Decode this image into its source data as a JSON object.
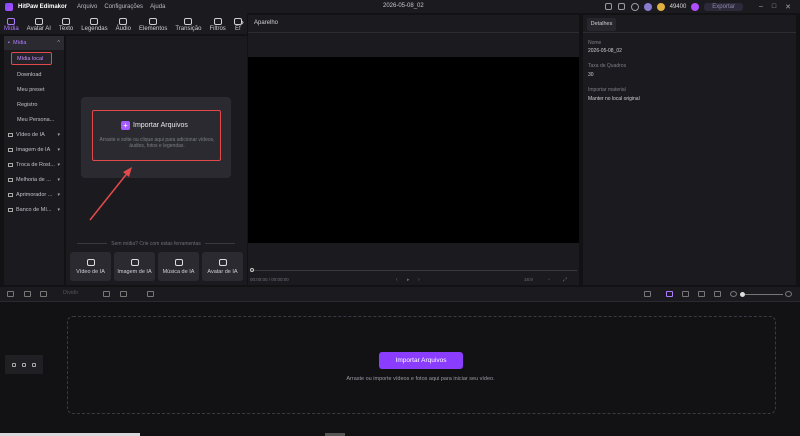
{
  "titlebar": {
    "app_name": "HitPaw Edimakor",
    "menu": [
      "Arquivo",
      "Configurações",
      "Ajuda"
    ],
    "project_title": "2026-05-08_02",
    "credits": "49400",
    "export_label": "Exportar"
  },
  "toolbar": {
    "tools": [
      "Mídia",
      "Avatar AI",
      "Texto",
      "Legendas",
      "Áudio",
      "Elementos",
      "Transição",
      "Filtros",
      "Ef"
    ]
  },
  "sidebar": {
    "header": "Mídia",
    "sub_items": [
      "Mídia local",
      "Download",
      "Meu preset",
      "Registro",
      "Meu Persona..."
    ],
    "categories": [
      "Vídeo de IA",
      "Imagem de IA",
      "Troca de Rost...",
      "Melhoria de ...",
      "Aprimorador ...",
      "Banco de Mí..."
    ]
  },
  "media_panel": {
    "import_label": "Importar Arquivos",
    "import_hint": "Arraste e solte ou clique aqui para adicionar vídeos, áudios, fotos e legendas.",
    "no_media_text": "Sem mídia? Crie com estas ferramentas",
    "ai_tools": [
      "Vídeo de IA",
      "Imagem de IA",
      "Música de IA",
      "Avatar de IA"
    ]
  },
  "player": {
    "label": "Aparelho",
    "timecode": "00:00:00 / 00:00:00",
    "ratio": "16:9"
  },
  "details": {
    "tab": "Detalhes",
    "fields": [
      {
        "label": "Nome",
        "value": "2026-05-08_02"
      },
      {
        "label": "Taxa de Quadros",
        "value": "30"
      },
      {
        "label": "Importar material",
        "value": "Manter no local original"
      }
    ]
  },
  "timeline_toolbar": {
    "split_label": "Dividir"
  },
  "timeline": {
    "import_label": "Importar Arquivos",
    "hint": "Arraste ou importe vídeos e fotos aqui para iniciar seu vídeo."
  }
}
